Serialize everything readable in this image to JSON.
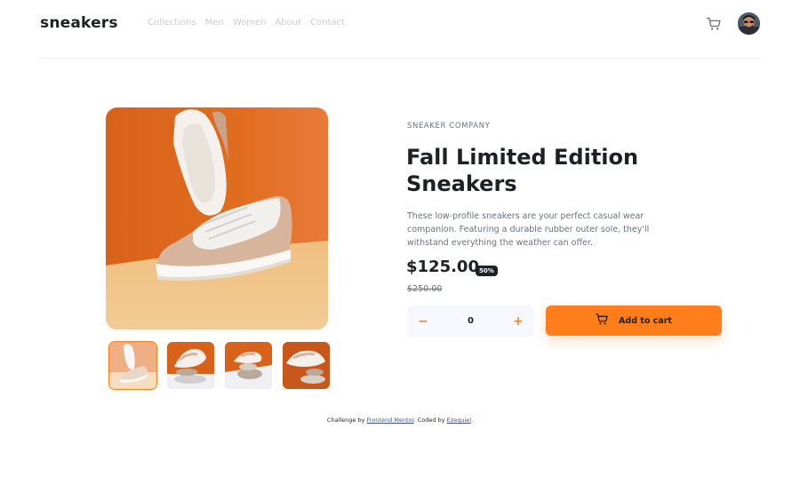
{
  "header": {
    "logo": "sneakers",
    "nav": [
      "Collections",
      "Men",
      "Women",
      "About",
      "Contact"
    ],
    "cart_icon": "cart-icon",
    "avatar_icon": "avatar"
  },
  "product": {
    "company": "SNEAKER COMPANY",
    "title": "Fall Limited Edition Sneakers",
    "description": "These low-profile sneakers are your perfect casual wear companion. Featuring a durable rubber outer sole, they'll withstand everything the weather can offer.",
    "price": "$125.00",
    "discount": "50%",
    "old_price": "$250.00",
    "quantity": "0",
    "minus_label": "−",
    "plus_label": "+",
    "add_to_cart": "Add to cart"
  },
  "gallery": {
    "thumbnails": 4,
    "active_thumbnail": 1
  },
  "footer": {
    "prefix": "Challenge by ",
    "link1": "Frontend Mentor",
    "middle": ". Coded by ",
    "link2": "Ezequiel",
    "suffix": "."
  },
  "colors": {
    "accent": "#ff7d1a",
    "dark": "#1d2026",
    "muted": "#69707d",
    "light_bg": "#f6f8fd"
  }
}
